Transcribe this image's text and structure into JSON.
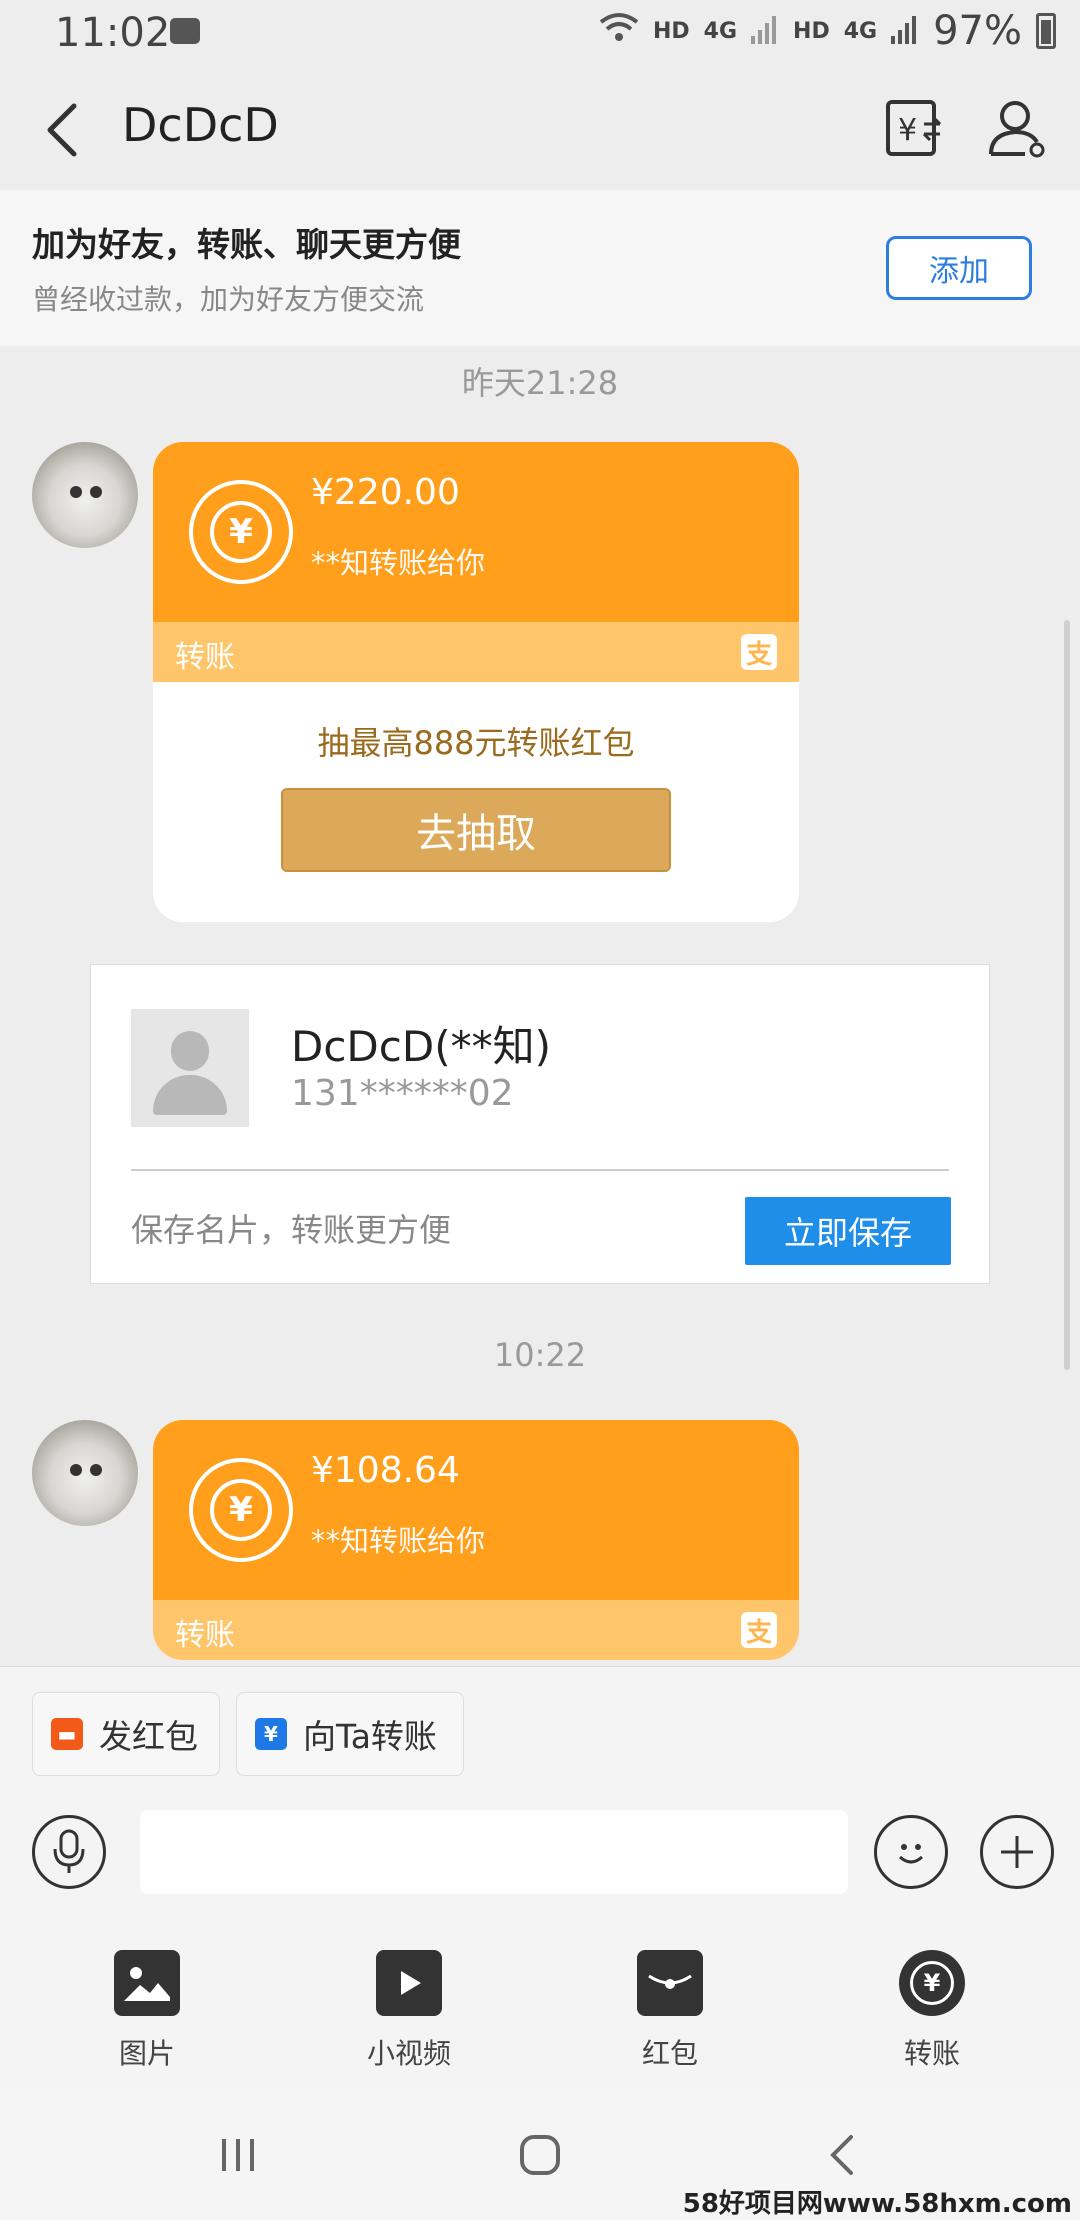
{
  "status": {
    "time": "11:02",
    "hd1": "HD",
    "net1": "4G",
    "hd2": "HD",
    "net2": "4G",
    "battery": "97%"
  },
  "header": {
    "title": "DcDcD"
  },
  "banner": {
    "title": "加为好友，转账、聊天更方便",
    "subtitle": "曾经收过款，加为好友方便交流",
    "add_label": "添加"
  },
  "messages": [
    {
      "timestamp": "昨天21:28",
      "amount": "¥220.00",
      "note": "**知转账给你",
      "type_label": "转账",
      "alipay_icon": "支",
      "promo": "抽最高888元转账红包",
      "button": "去抽取"
    },
    {
      "timestamp": "10:22",
      "amount": "¥108.64",
      "note": "**知转账给你",
      "type_label": "转账",
      "alipay_icon": "支"
    }
  ],
  "contact_card": {
    "name": "DcDcD(**知)",
    "phone": "131******02",
    "tip": "保存名片，转账更方便",
    "save_label": "立即保存"
  },
  "quick_actions": [
    {
      "label": "发红包",
      "color": "#f25a1a"
    },
    {
      "label": "向Ta转账",
      "color": "#1e78e6"
    }
  ],
  "input": {
    "placeholder": "",
    "value": ""
  },
  "tools": [
    {
      "label": "图片",
      "icon": "image-icon"
    },
    {
      "label": "小视频",
      "icon": "video-icon"
    },
    {
      "label": "红包",
      "icon": "red-packet-icon"
    },
    {
      "label": "转账",
      "icon": "transfer-icon"
    }
  ],
  "watermark": "58好项目网www.58hxm.com"
}
